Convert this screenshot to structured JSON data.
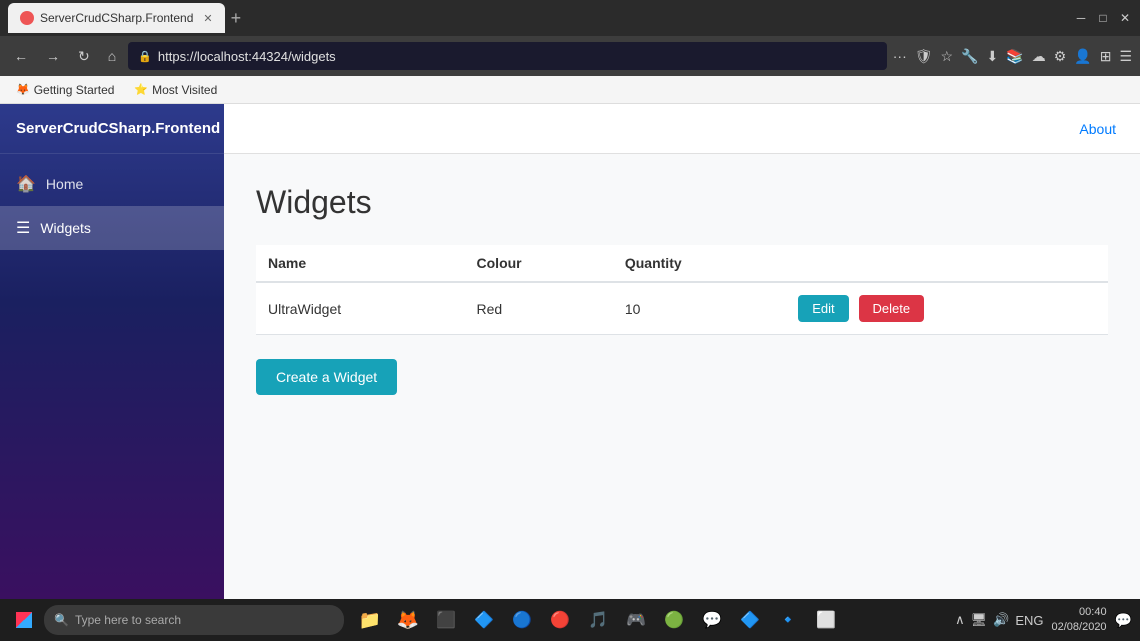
{
  "browser": {
    "tab_title": "ServerCrudCSharp.Frontend",
    "url": "https://localhost:44324/widgets",
    "new_tab_symbol": "+",
    "nav_back": "←",
    "nav_forward": "→",
    "nav_refresh": "↻",
    "nav_home": "⌂",
    "window_minimize": "─",
    "window_maximize": "□",
    "window_close": "✕"
  },
  "bookmarks": [
    {
      "label": "Getting Started",
      "icon": "🦊"
    },
    {
      "label": "Most Visited",
      "icon": "⭐"
    }
  ],
  "sidebar": {
    "brand": "ServerCrudCSharp.Frontend",
    "items": [
      {
        "label": "Home",
        "icon": "🏠",
        "active": false
      },
      {
        "label": "Widgets",
        "icon": "☰",
        "active": true
      }
    ]
  },
  "header": {
    "about_label": "About"
  },
  "page": {
    "title": "Widgets",
    "table": {
      "columns": [
        "Name",
        "Colour",
        "Quantity"
      ],
      "rows": [
        {
          "name": "UltraWidget",
          "colour": "Red",
          "quantity": "10"
        }
      ]
    },
    "edit_button": "Edit",
    "delete_button": "Delete",
    "create_button": "Create a Widget"
  },
  "taskbar": {
    "search_placeholder": "Type here to search",
    "time": "00:40",
    "date": "02/08/2020",
    "lang": "ENG"
  }
}
